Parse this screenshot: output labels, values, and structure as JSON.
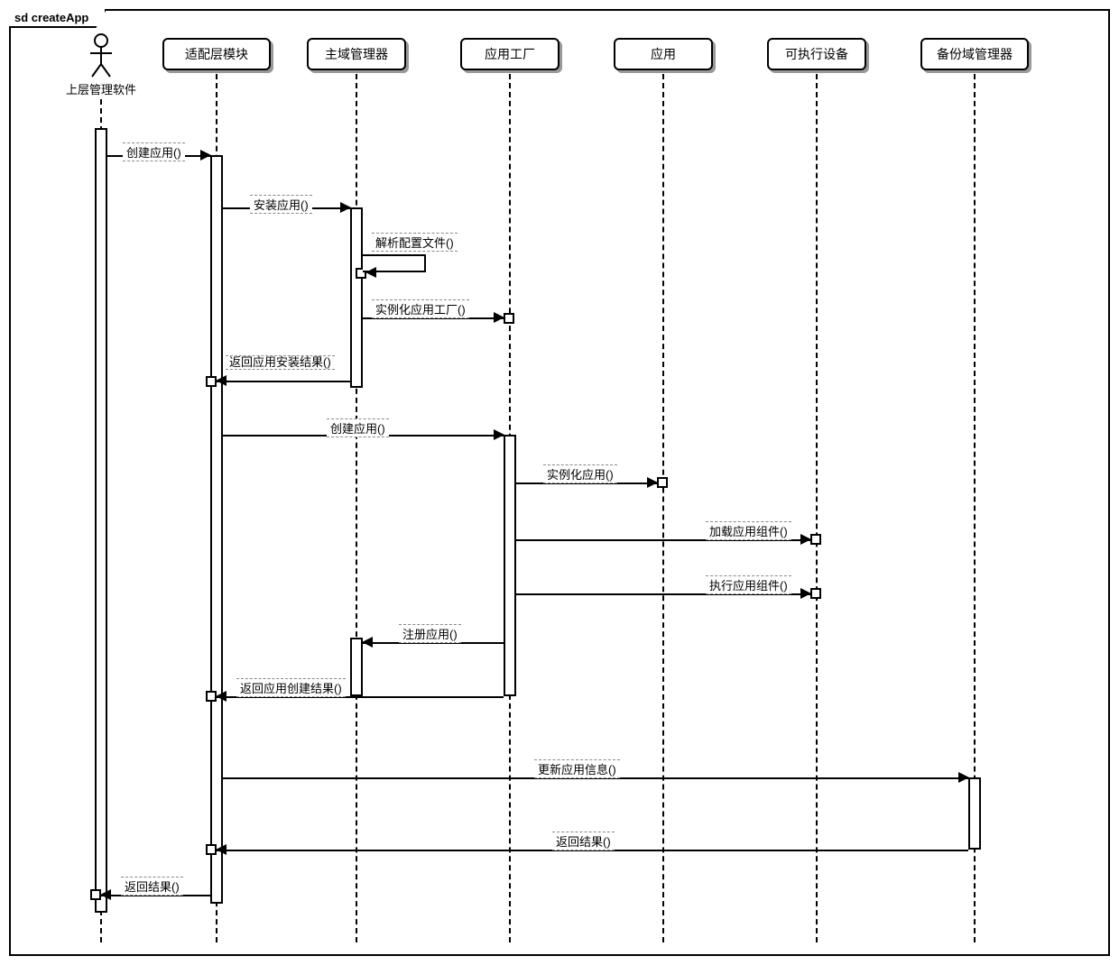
{
  "frame_title": "sd createApp",
  "actor": {
    "label": "上层管理软件"
  },
  "participants": {
    "p1": "适配层模块",
    "p2": "主域管理器",
    "p3": "应用工厂",
    "p4": "应用",
    "p5": "可执行设备",
    "p6": "备份域管理器"
  },
  "messages": {
    "m1": "创建应用()",
    "m2": "安装应用()",
    "m3": "解析配置文件()",
    "m4": "实例化应用工厂()",
    "m5": "返回应用安装结果()",
    "m6": "创建应用()",
    "m7": "实例化应用()",
    "m8": "加载应用组件()",
    "m9": "执行应用组件()",
    "m10": "注册应用()",
    "m11": "返回应用创建结果()",
    "m12": "更新应用信息()",
    "m13": "返回结果()",
    "m14": "返回结果()"
  },
  "chart_data": {
    "type": "sequence_diagram",
    "title": "sd createApp",
    "participants": [
      {
        "id": "actor",
        "name": "上层管理软件",
        "type": "actor"
      },
      {
        "id": "p1",
        "name": "适配层模块",
        "type": "object"
      },
      {
        "id": "p2",
        "name": "主域管理器",
        "type": "object"
      },
      {
        "id": "p3",
        "name": "应用工厂",
        "type": "object"
      },
      {
        "id": "p4",
        "name": "应用",
        "type": "object"
      },
      {
        "id": "p5",
        "name": "可执行设备",
        "type": "object"
      },
      {
        "id": "p6",
        "name": "备份域管理器",
        "type": "object"
      }
    ],
    "messages": [
      {
        "from": "actor",
        "to": "p1",
        "label": "创建应用()",
        "return": false
      },
      {
        "from": "p1",
        "to": "p2",
        "label": "安装应用()",
        "return": false
      },
      {
        "from": "p2",
        "to": "p2",
        "label": "解析配置文件()",
        "return": false,
        "self": true
      },
      {
        "from": "p2",
        "to": "p3",
        "label": "实例化应用工厂()",
        "return": false
      },
      {
        "from": "p2",
        "to": "p1",
        "label": "返回应用安装结果()",
        "return": true
      },
      {
        "from": "p1",
        "to": "p3",
        "label": "创建应用()",
        "return": false
      },
      {
        "from": "p3",
        "to": "p4",
        "label": "实例化应用()",
        "return": false
      },
      {
        "from": "p3",
        "to": "p5",
        "label": "加载应用组件()",
        "return": false
      },
      {
        "from": "p3",
        "to": "p5",
        "label": "执行应用组件()",
        "return": false
      },
      {
        "from": "p3",
        "to": "p2",
        "label": "注册应用()",
        "return": true
      },
      {
        "from": "p3",
        "to": "p1",
        "label": "返回应用创建结果()",
        "return": true
      },
      {
        "from": "p1",
        "to": "p6",
        "label": "更新应用信息()",
        "return": false
      },
      {
        "from": "p6",
        "to": "p1",
        "label": "返回结果()",
        "return": true
      },
      {
        "from": "p1",
        "to": "actor",
        "label": "返回结果()",
        "return": true
      }
    ]
  }
}
